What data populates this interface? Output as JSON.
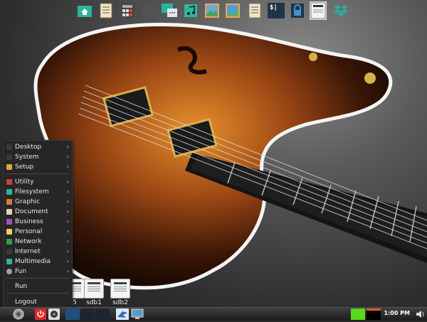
{
  "top_launchers": [
    {
      "name": "home-folder-icon",
      "color": "#2bb59a"
    },
    {
      "name": "text-editor-icon",
      "color": "#f2e6c4"
    },
    {
      "name": "calculator-icon",
      "color": "#444444"
    },
    {
      "name": "browser-globe-icon",
      "color": "#666666"
    },
    {
      "name": "chat-messenger-icon",
      "color": "#29b39a"
    },
    {
      "name": "music-player-icon",
      "color": "#2fb7a0"
    },
    {
      "name": "image-viewer-icon",
      "color": "#f2a54a"
    },
    {
      "name": "paint-icon",
      "color": "#4aa0d8"
    },
    {
      "name": "notes-icon",
      "color": "#f2e6c4"
    },
    {
      "name": "terminal-icon",
      "color": "#1f3448"
    },
    {
      "name": "lock-screen-icon",
      "color": "#2c5f86"
    },
    {
      "name": "removable-drive-icon",
      "color": "#f4f4f4"
    },
    {
      "name": "dropbox-icon",
      "color": "#27b0a0"
    }
  ],
  "terminal_label": "$|",
  "desktop_drives": [
    {
      "label": "5"
    },
    {
      "label": "sdb1"
    },
    {
      "label": "sdb2"
    }
  ],
  "menu": {
    "items": [
      {
        "label": "Desktop",
        "icon": "desktop-icon",
        "color": "#3a3a3a",
        "arrow": "›"
      },
      {
        "label": "System",
        "icon": "system-icon",
        "color": "#3a3a3a",
        "arrow": "›"
      },
      {
        "label": "Setup",
        "icon": "setup-wrench-icon",
        "color": "#d9a83a",
        "arrow": "›"
      },
      {
        "label": "Utility",
        "icon": "utility-icon",
        "color": "#c84040",
        "arrow": "›"
      },
      {
        "label": "Filesystem",
        "icon": "filesystem-icon",
        "color": "#2bb59a",
        "arrow": "›"
      },
      {
        "label": "Graphic",
        "icon": "graphic-icon",
        "color": "#e07a40",
        "arrow": "›"
      },
      {
        "label": "Document",
        "icon": "document-icon",
        "color": "#e7d7b0",
        "arrow": "›"
      },
      {
        "label": "Business",
        "icon": "business-icon",
        "color": "#a050c0",
        "arrow": "›"
      },
      {
        "label": "Personal",
        "icon": "personal-icon",
        "color": "#f0d060",
        "arrow": "›"
      },
      {
        "label": "Network",
        "icon": "network-icon",
        "color": "#2fa040",
        "arrow": "›"
      },
      {
        "label": "Internet",
        "icon": "internet-icon",
        "color": "#3a3a3a",
        "arrow": "›"
      },
      {
        "label": "Multimedia",
        "icon": "multimedia-icon",
        "color": "#30b0a0",
        "arrow": "›"
      },
      {
        "label": "Fun",
        "icon": "fun-icon",
        "color": "#a0a0a0",
        "arrow": "›"
      }
    ],
    "run_label": "Run",
    "logout_label": "Logout"
  },
  "taskbar": {
    "clock": "1:00 PM"
  }
}
